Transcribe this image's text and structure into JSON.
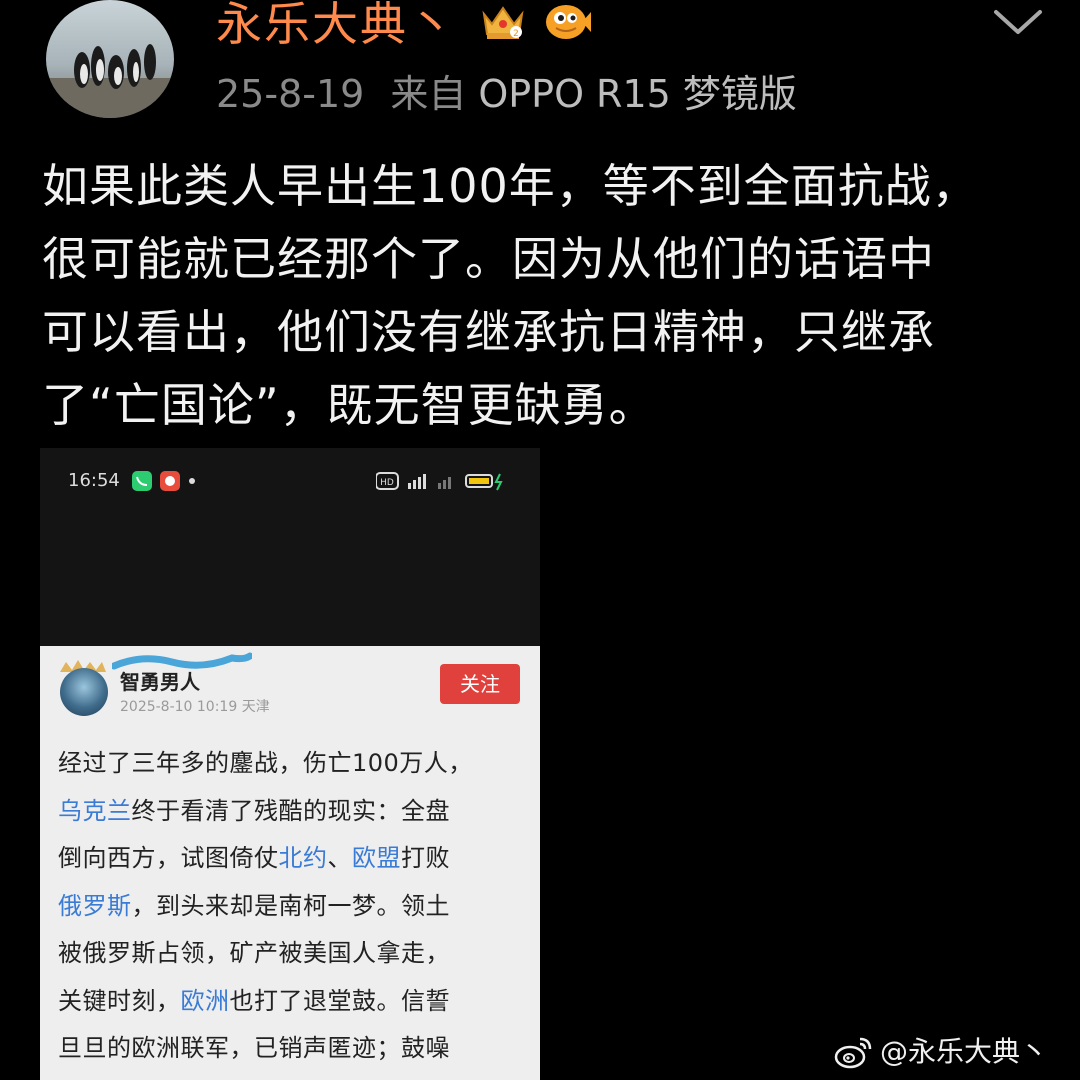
{
  "post": {
    "username": "永乐大典丶",
    "date": "25-8-19",
    "source_prefix": "来自",
    "device": "OPPO R15 梦镜版",
    "badges": [
      "crown-badge-icon",
      "fish-badge-icon"
    ],
    "text_lines": [
      "如果此类人早出生100年，等不到全面抗战，",
      "很可能就已经那个了。因为从他们的话语中",
      "可以看出，他们没有继承抗日精神，只继承",
      "了“亡国论”，既无智更缺勇。"
    ]
  },
  "embedded_screenshot": {
    "status_time": "16:54",
    "status_right": "HD",
    "card": {
      "username": "智勇男人",
      "timestamp": "2025-8-10 10:19 天津",
      "follow_label": "关注",
      "lines": [
        [
          {
            "t": "经过了三年多的鏖战，伤亡100万人，",
            "link": false
          }
        ],
        [
          {
            "t": "乌克兰",
            "link": true
          },
          {
            "t": "终于看清了残酷的现实：全盘",
            "link": false
          }
        ],
        [
          {
            "t": "倒向西方，试图倚仗",
            "link": false
          },
          {
            "t": "北约",
            "link": true
          },
          {
            "t": "、",
            "link": false
          },
          {
            "t": "欧盟",
            "link": true
          },
          {
            "t": "打败",
            "link": false
          }
        ],
        [
          {
            "t": "俄罗斯",
            "link": true
          },
          {
            "t": "，到头来却是南柯一梦。领土",
            "link": false
          }
        ],
        [
          {
            "t": "被俄罗斯占领，矿产被美国人拿走，",
            "link": false
          }
        ],
        [
          {
            "t": "关键时刻，",
            "link": false
          },
          {
            "t": "欧洲",
            "link": true
          },
          {
            "t": "也打了退堂鼓。信誓",
            "link": false
          }
        ],
        [
          {
            "t": "旦旦的欧洲联军，已销声匿迹；鼓噪",
            "link": false
          }
        ]
      ]
    }
  },
  "watermark": {
    "text": "@永乐大典丶"
  },
  "colors": {
    "username": "#ff8a4c",
    "link": "#3a7bd5",
    "follow_button": "#e0413c"
  }
}
